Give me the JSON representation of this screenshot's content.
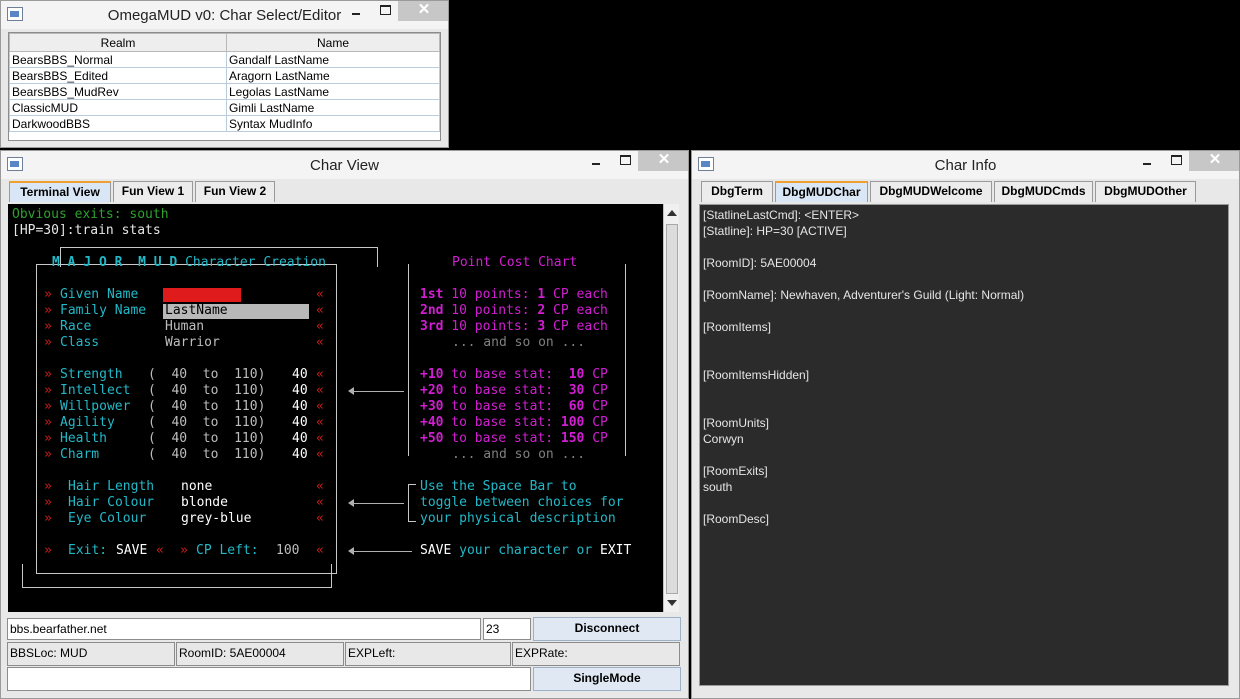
{
  "select_window": {
    "title": "OmegaMUD v0: Char Select/Editor",
    "columns": [
      "Realm",
      "Name"
    ],
    "rows": [
      {
        "realm": "BearsBBS_Normal",
        "name": "Gandalf LastName"
      },
      {
        "realm": "BearsBBS_Edited",
        "name": "Aragorn LastName"
      },
      {
        "realm": "BearsBBS_MudRev",
        "name": "Legolas LastName"
      },
      {
        "realm": "ClassicMUD",
        "name": "Gimli LastName"
      },
      {
        "realm": "DarkwoodBBS",
        "name": "Syntax MudInfo"
      }
    ]
  },
  "char_view": {
    "title": "Char View",
    "tabs": [
      "Terminal View",
      "Fun View 1",
      "Fun View 2"
    ],
    "terminal": {
      "exits_line": "Obvious exits: south",
      "prompt_line": "[HP=30]:train stats",
      "header_major": "M A J O R  M U D",
      "header_cc": "Character Creation",
      "point_chart_title": "Point Cost Chart",
      "marker_left": "»",
      "marker_right": "«",
      "labels": [
        "Given Name",
        "Family Name",
        "Race",
        "Class"
      ],
      "family_value": "LastName",
      "race_value": "Human",
      "class_value": "Warrior",
      "stats": [
        {
          "name": "Strength",
          "range": "(  40  to  110)",
          "value": "40"
        },
        {
          "name": "Intellect",
          "range": "(  40  to  110)",
          "value": "40"
        },
        {
          "name": "Willpower",
          "range": "(  40  to  110)",
          "value": "40"
        },
        {
          "name": "Agility",
          "range": "(  40  to  110)",
          "value": "40"
        },
        {
          "name": "Health",
          "range": "(  40  to  110)",
          "value": "40"
        },
        {
          "name": "Charm",
          "range": "(  40  to  110)",
          "value": "40"
        }
      ],
      "hair_length_label": "Hair Length",
      "hair_length": "none",
      "hair_colour_label": "Hair Colour",
      "hair_colour": "blonde",
      "eye_colour_label": "Eye Colour",
      "eye_colour": "grey-blue",
      "exit_label": "Exit:",
      "save_label": "SAVE",
      "cp_label": "CP Left:",
      "cp_value": "100",
      "cost_lines": [
        {
          "ord": "1st",
          "txt": " 10 points: ",
          "num": "1",
          "tail": " CP each"
        },
        {
          "ord": "2nd",
          "txt": " 10 points: ",
          "num": "2",
          "tail": " CP each"
        },
        {
          "ord": "3rd",
          "txt": " 10 points: ",
          "num": "3",
          "tail": " CP each"
        }
      ],
      "and_so_on": "... and so on ...",
      "base_lines": [
        {
          "plus": "+10",
          "txt": " to base stat:  ",
          "num": "10",
          "tail": " CP"
        },
        {
          "plus": "+20",
          "txt": " to base stat:  ",
          "num": "30",
          "tail": " CP"
        },
        {
          "plus": "+30",
          "txt": " to base stat:  ",
          "num": "60",
          "tail": " CP"
        },
        {
          "plus": "+40",
          "txt": " to base stat: ",
          "num": "100",
          "tail": " CP"
        },
        {
          "plus": "+50",
          "txt": " to base stat: ",
          "num": "150",
          "tail": " CP"
        }
      ],
      "space_help": [
        "Use the Space Bar to",
        "toggle between choices for",
        "your physical description"
      ],
      "save_help_a": "SAVE",
      "save_help_b": " your character or ",
      "save_help_c": "EXIT"
    },
    "host": "bbs.bearfather.net",
    "port": "23",
    "disconnect_label": "Disconnect",
    "bbsloc": "BBSLoc: MUD",
    "roomid": "RoomID: 5AE00004",
    "expleft": "EXPLeft:",
    "exprate": "EXPRate:",
    "singlemode_label": "SingleMode"
  },
  "char_info": {
    "title": "Char Info",
    "tabs": [
      "DbgTerm",
      "DbgMUDChar",
      "DbgMUDWelcome",
      "DbgMUDCmds",
      "DbgMUDOther"
    ],
    "lines": [
      "[StatlineLastCmd]: <ENTER>",
      "[Statline]: HP=30 [ACTIVE]",
      "",
      "[RoomID]: 5AE00004",
      "",
      "[RoomName]: Newhaven, Adventurer's Guild (Light: Normal)",
      "",
      "[RoomItems]",
      "",
      "",
      "[RoomItemsHidden]",
      "",
      "",
      "[RoomUnits]",
      "Corwyn",
      "",
      "[RoomExits]",
      "south",
      "",
      "[RoomDesc]"
    ]
  }
}
